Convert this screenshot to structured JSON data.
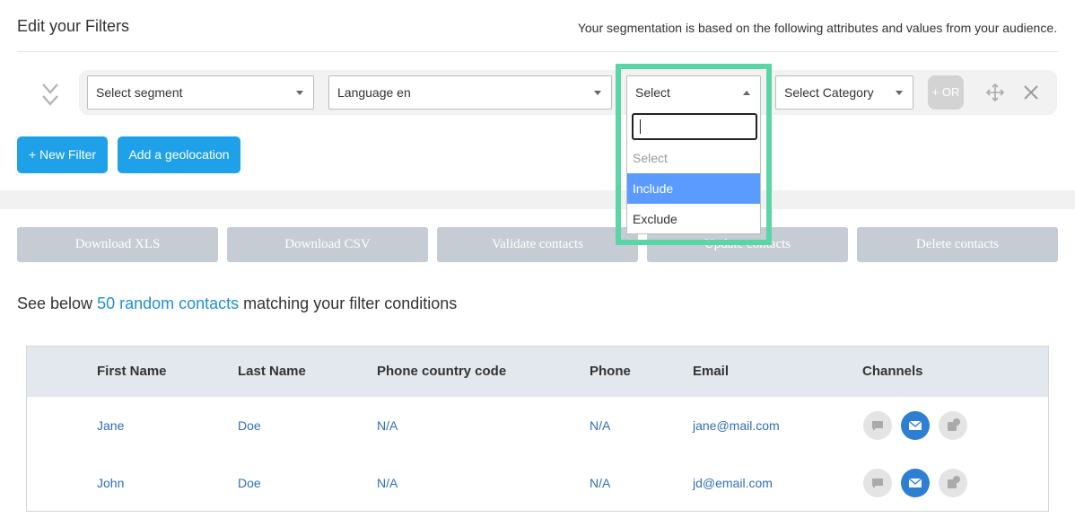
{
  "header": {
    "title": "Edit your Filters",
    "description": "Your segmentation is based on the following attributes and values from your audience."
  },
  "filter": {
    "segment_select": "Select segment",
    "attribute_select": "Language en",
    "operator_select": "Select",
    "category_select": "Select Category",
    "or_label": "+ OR"
  },
  "dropdown": {
    "search_value": "",
    "options": [
      "Select",
      "Include",
      "Exclude"
    ],
    "highlighted": "Include"
  },
  "buttons": {
    "new_filter": "+ New Filter",
    "add_geolocation": "Add a geolocation"
  },
  "actions": [
    "Download XLS",
    "Download CSV",
    "Validate contacts",
    "Update contacts",
    "Delete contacts"
  ],
  "summary": {
    "prefix": "See below ",
    "link": "50 random contacts",
    "suffix": " matching your filter conditions"
  },
  "table": {
    "columns": [
      "First Name",
      "Last Name",
      "Phone country code",
      "Phone",
      "Email",
      "Channels"
    ],
    "rows": [
      [
        "Jane",
        "Doe",
        "N/A",
        "N/A",
        "jane@mail.com"
      ],
      [
        "John",
        "Doe",
        "N/A",
        "N/A",
        "jd@email.com"
      ]
    ]
  },
  "colors": {
    "primary": "#1ea1e8",
    "highlight_border": "#5bd5a6",
    "option_selected": "#5b9bff",
    "disabled_button": "#c5ccd3",
    "channel_active": "#2d7fd3"
  },
  "icons": [
    "chevrons-down-icon",
    "move-icon",
    "close-icon",
    "sms-icon",
    "email-icon",
    "push-icon",
    "caret-down-icon",
    "caret-up-icon"
  ]
}
